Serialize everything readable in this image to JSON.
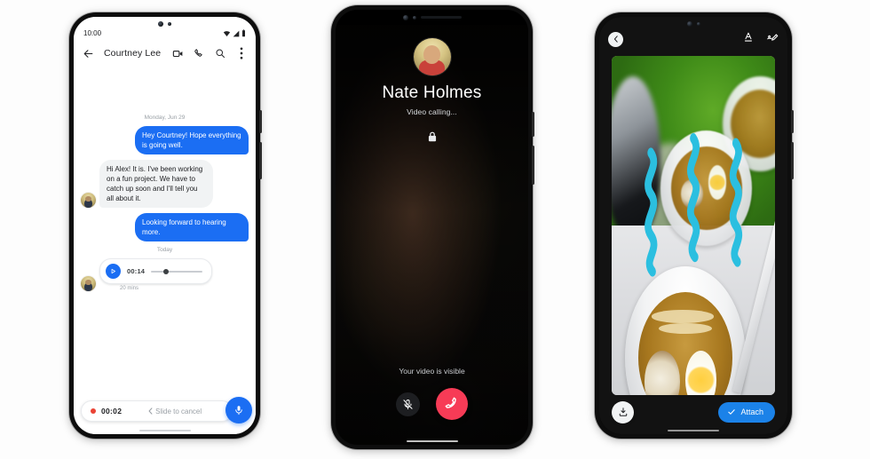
{
  "background_color": "#fdfdfd",
  "accent_blue": "#1b6ef3",
  "accent_red": "#ea4335",
  "doodle_cyan": "#2bbfe0",
  "phones": {
    "messages": {
      "device_name": "pixel-phone-messages",
      "statusbar": {
        "time": "10:00",
        "icons": [
          "wifi-icon",
          "signal-icon",
          "battery-icon"
        ]
      },
      "appbar": {
        "back_icon": "back-arrow-icon",
        "title": "Courtney Lee",
        "actions": [
          "video-call-icon",
          "phone-call-icon",
          "search-icon",
          "overflow-menu-icon"
        ]
      },
      "day_separator": "Monday, Jun 29",
      "messages": [
        {
          "side": "out",
          "text": "Hey Courtney! Hope everything is going well."
        },
        {
          "side": "in",
          "text": "Hi Alex! It is. I've been working on a fun project. We have to catch up soon and I'll tell you all about it."
        },
        {
          "side": "out",
          "text": "Looking forward to hearing more."
        }
      ],
      "second_separator": "Today",
      "voice_message": {
        "play_icon": "play-icon",
        "duration": "00:14",
        "progress_percent": 24,
        "timestamp": "20 mins"
      },
      "recording_bar": {
        "record_indicator": "record-dot-icon",
        "elapsed": "00:02",
        "chevron_icon": "chevron-left-icon",
        "hint": "Slide to cancel",
        "mic_icon": "microphone-icon"
      }
    },
    "video_call": {
      "device_name": "pixel-phone-video-call",
      "caller_name": "Nate Holmes",
      "call_status": "Video calling...",
      "encryption_icon": "lock-icon",
      "self_video_status": "Your video is visible",
      "controls": [
        {
          "name": "mute-button",
          "icon": "mic-off-icon"
        },
        {
          "name": "end-call-button",
          "icon": "end-call-icon"
        }
      ]
    },
    "photo_editor": {
      "device_name": "pixel-phone-photo-editor",
      "top_actions": [
        {
          "name": "back-button",
          "icon": "chevron-left-icon"
        },
        {
          "name": "text-tool-button",
          "icon": "text-format-icon"
        },
        {
          "name": "draw-tool-button",
          "icon": "scribble-pen-icon"
        }
      ],
      "photo_description": "ramen-bowl-photo",
      "doodle": {
        "icon": "steam-squiggle-doodle",
        "count": 3
      },
      "bottom_actions": {
        "save_icon": "download-icon",
        "attach_icon": "check-icon",
        "attach_label": "Attach"
      }
    }
  }
}
